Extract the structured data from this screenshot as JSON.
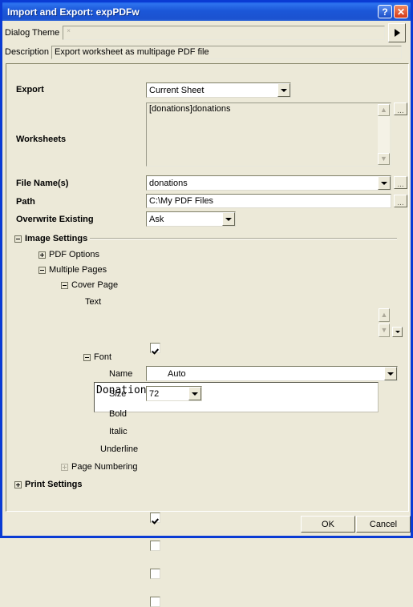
{
  "window": {
    "title": "Import and Export: expPDFw",
    "help_button": "?",
    "close_button": "✕"
  },
  "theme_row": {
    "label": "Dialog Theme",
    "value": "×",
    "expand_button": "play-arrow"
  },
  "description_row": {
    "label": "Description",
    "value": "Export worksheet as multipage PDF file"
  },
  "form": {
    "export": {
      "label": "Export",
      "value": "Current Sheet"
    },
    "worksheets": {
      "label": "Worksheets",
      "items": [
        "[donations]donations"
      ],
      "browse": "..."
    },
    "file_names": {
      "label": "File Name(s)",
      "value": "donations",
      "browse": "..."
    },
    "path": {
      "label": "Path",
      "value": "C:\\My PDF Files",
      "browse": "..."
    },
    "overwrite": {
      "label": "Overwrite Existing",
      "value": "Ask"
    }
  },
  "tree": {
    "image_settings": {
      "label": "Image Settings",
      "state": "expanded"
    },
    "pdf_options": {
      "label": "PDF Options",
      "state": "collapsed"
    },
    "multiple_pages": {
      "label": "Multiple Pages",
      "state": "expanded"
    },
    "cover_page": {
      "label": "Cover Page",
      "state": "expanded",
      "checked": true
    },
    "text": {
      "label": "Text",
      "value": "Donations"
    },
    "font": {
      "label": "Font",
      "state": "expanded"
    },
    "font_name": {
      "label": "Name",
      "value": "Auto"
    },
    "font_size": {
      "label": "Size",
      "value": "72"
    },
    "font_bold": {
      "label": "Bold",
      "checked": true
    },
    "font_italic": {
      "label": "Italic",
      "checked": false
    },
    "font_underline": {
      "label": "Underline",
      "checked": false
    },
    "page_numbering": {
      "label": "Page Numbering",
      "state": "collapsed-disabled",
      "checked": false
    },
    "print_settings": {
      "label": "Print Settings",
      "state": "collapsed"
    }
  },
  "footer": {
    "ok": "OK",
    "cancel": "Cancel"
  },
  "colors": {
    "window_frame": "#0A3BD4",
    "face": "#ECE9D8",
    "title_text": "#FFFFFF",
    "close_button": "#D63A18"
  }
}
